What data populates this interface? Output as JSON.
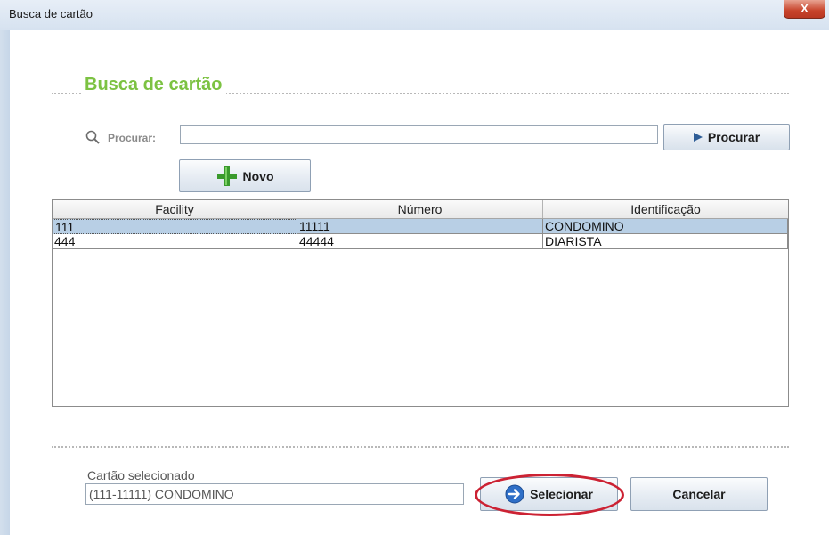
{
  "window": {
    "title": "Busca de cartão",
    "close_label": "X"
  },
  "section": {
    "title": "Busca de cartão"
  },
  "search": {
    "label": "Procurar:",
    "value": "",
    "button_label": "Procurar"
  },
  "new_button": {
    "label": "Novo"
  },
  "table": {
    "columns": [
      "Facility",
      "Número",
      "Identificação"
    ],
    "rows": [
      [
        "111",
        "11111",
        "CONDOMINO"
      ],
      [
        "444",
        "44444",
        "DIARISTA"
      ]
    ],
    "selected_row": 0
  },
  "selected_card": {
    "label": "Cartão selecionado",
    "value": "(111-11111) CONDOMINO"
  },
  "actions": {
    "select_label": "Selecionar",
    "cancel_label": "Cancelar"
  },
  "colors": {
    "section_title": "#7cc242",
    "selection": "#b8cfe5",
    "highlight_ellipse": "#cc2233",
    "close_button": "#c7432b"
  },
  "icons": {
    "search": "magnifier-icon",
    "new": "plus-icon",
    "procurar": "play-arrow-icon",
    "select": "circle-arrow-right-icon"
  }
}
